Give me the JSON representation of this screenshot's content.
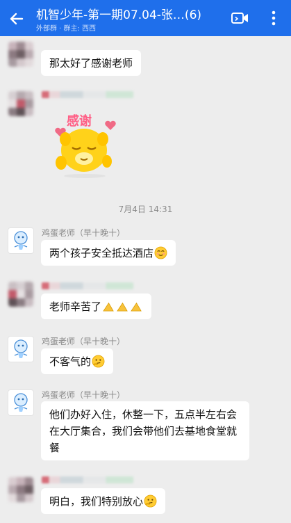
{
  "header": {
    "title": "机智少年-第一期07.04-张…(6)",
    "subtitle": "外部群 · 群主: 西西",
    "back_icon": "arrow-left-icon",
    "video_icon": "video-call-icon",
    "more_icon": "more-vertical-icon"
  },
  "messages": [
    {
      "sender": "",
      "text": "那太好了感谢老师"
    },
    {
      "sender": "",
      "sticker": "感谢"
    },
    {
      "timestamp": "7月4日  14:31"
    },
    {
      "sender": "鸡蛋老师（早十晚十）",
      "text": "两个孩子安全抵达酒店"
    },
    {
      "sender": "",
      "text": "老师辛苦了"
    },
    {
      "sender": "鸡蛋老师（早十晚十）",
      "text": "不客气的"
    },
    {
      "sender": "鸡蛋老师（早十晚十）",
      "text": "他们办好入住，休整一下，五点半左右会在大厅集合，我们会带他们去基地食堂就餐"
    },
    {
      "sender": "",
      "text": "明白，我们特别放心"
    }
  ],
  "colors": {
    "header": "#1f6feb",
    "background": "#ededed",
    "bubble": "#ffffff"
  }
}
